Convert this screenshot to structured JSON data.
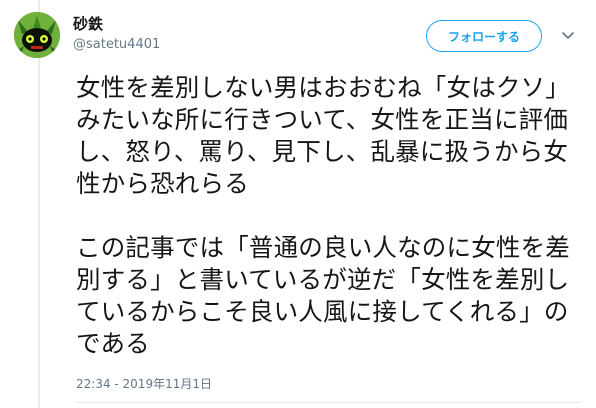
{
  "user": {
    "display_name": "砂鉄",
    "handle": "@satetu4401"
  },
  "follow_button": {
    "label": "フォローする"
  },
  "tweet": {
    "paragraphs": [
      "女性を差別しない男はおおむね「女はクソ」みたいな所に行きついて、女性を正当に評価し、怒り、罵り、見下し、乱暴に扱うから女性から恐れらる",
      "この記事では「普通の良い人なのに女性を差別する」と書いているが逆だ「女性を差別しているからこそ良い人風に接してくれる」のである"
    ],
    "timestamp": "22:34 - 2019年11月1日"
  },
  "icons": {
    "avatar": "avatar-icon",
    "more": "chevron-down-icon"
  },
  "colors": {
    "accent": "#1da1f2",
    "text": "#14171a",
    "secondary": "#657786",
    "divider": "#e6ecf0"
  }
}
